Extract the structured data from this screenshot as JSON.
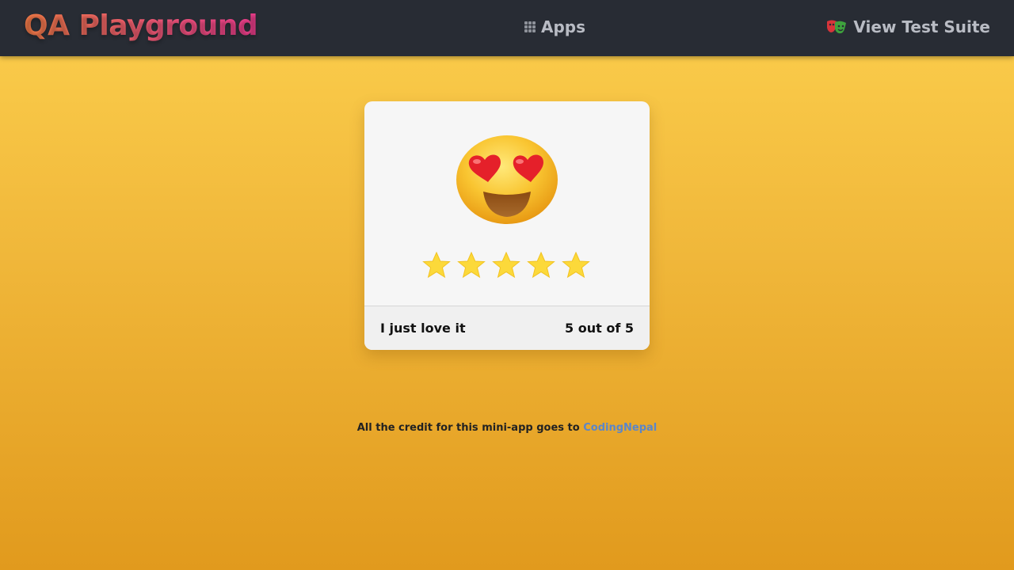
{
  "navbar": {
    "brand": "QA Playground",
    "apps_label": "Apps",
    "apps_icon": "grid-icon",
    "suite_label": "View Test Suite",
    "suite_icon": "theater-masks-icon"
  },
  "card": {
    "emoji": "heart-eyes-emoji",
    "rating": 5,
    "max_rating": 5,
    "star_color": "#fcd93a",
    "feedback_text": "I just love it",
    "rating_text": "5 out of 5"
  },
  "footer": {
    "credit_text": "All the credit for this mini-app goes to",
    "credit_link": "CodingNepal"
  },
  "colors": {
    "navbar_bg": "#282c34",
    "page_bg_top": "#fccf4d",
    "page_bg_bottom": "#e19a1d",
    "link": "#5b86c9"
  }
}
